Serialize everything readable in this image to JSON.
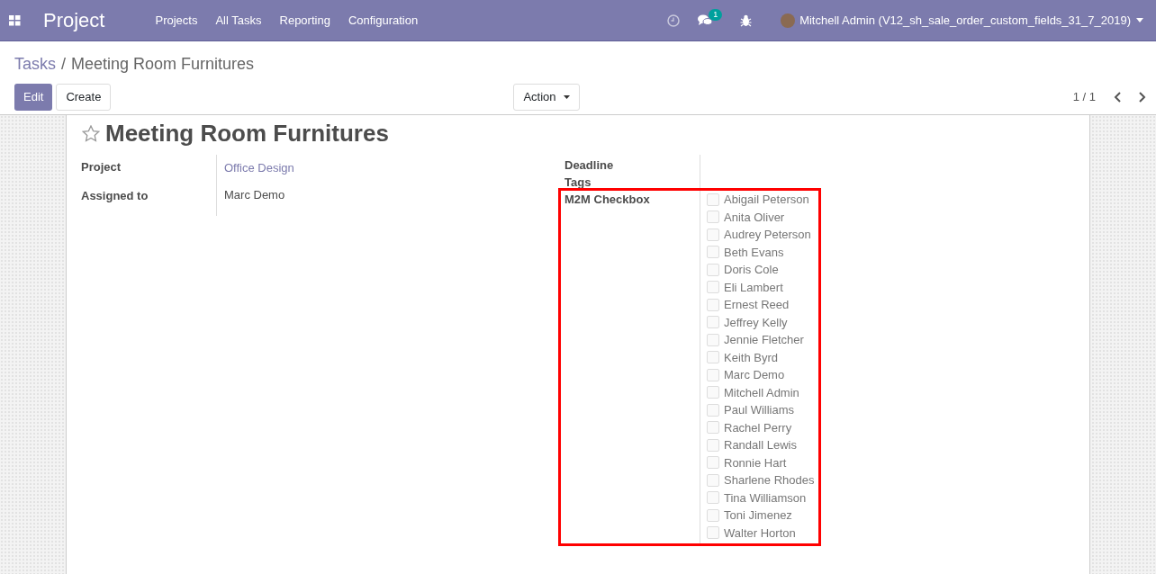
{
  "navbar": {
    "app_title": "Project",
    "menu": [
      "Projects",
      "All Tasks",
      "Reporting",
      "Configuration"
    ],
    "messages_badge": "1",
    "user": "Mitchell Admin (V12_sh_sale_order_custom_fields_31_7_2019)"
  },
  "breadcrumb": {
    "parent": "Tasks",
    "separator": "/",
    "current": "Meeting Room Furnitures"
  },
  "buttons": {
    "edit": "Edit",
    "create": "Create",
    "action": "Action"
  },
  "pager": "1 / 1",
  "form": {
    "title": "Meeting Room Furnitures",
    "starred": false,
    "left_fields": [
      {
        "label": "Project",
        "value": "Office Design",
        "kind": "link"
      },
      {
        "label": "Assigned to",
        "value": "Marc Demo",
        "kind": "text"
      }
    ],
    "right_fields": [
      {
        "label": "Deadline"
      },
      {
        "label": "Tags"
      }
    ],
    "checkbox_field": {
      "label": "M2M Checkbox",
      "highlighted": true,
      "options": [
        {
          "label": "Abigail Peterson",
          "checked": false
        },
        {
          "label": "Anita Oliver",
          "checked": false
        },
        {
          "label": "Audrey Peterson",
          "checked": false
        },
        {
          "label": "Beth Evans",
          "checked": false
        },
        {
          "label": "Doris Cole",
          "checked": false
        },
        {
          "label": "Eli Lambert",
          "checked": false
        },
        {
          "label": "Ernest Reed",
          "checked": false
        },
        {
          "label": "Jeffrey Kelly",
          "checked": false
        },
        {
          "label": "Jennie Fletcher",
          "checked": false
        },
        {
          "label": "Keith Byrd",
          "checked": false
        },
        {
          "label": "Marc Demo",
          "checked": false
        },
        {
          "label": "Mitchell Admin",
          "checked": false
        },
        {
          "label": "Paul Williams",
          "checked": false
        },
        {
          "label": "Rachel Perry",
          "checked": false
        },
        {
          "label": "Randall Lewis",
          "checked": false
        },
        {
          "label": "Ronnie Hart",
          "checked": false
        },
        {
          "label": "Sharlene Rhodes",
          "checked": false
        },
        {
          "label": "Tina Williamson",
          "checked": false
        },
        {
          "label": "Toni Jimenez",
          "checked": false
        },
        {
          "label": "Walter Horton",
          "checked": false
        }
      ]
    }
  }
}
